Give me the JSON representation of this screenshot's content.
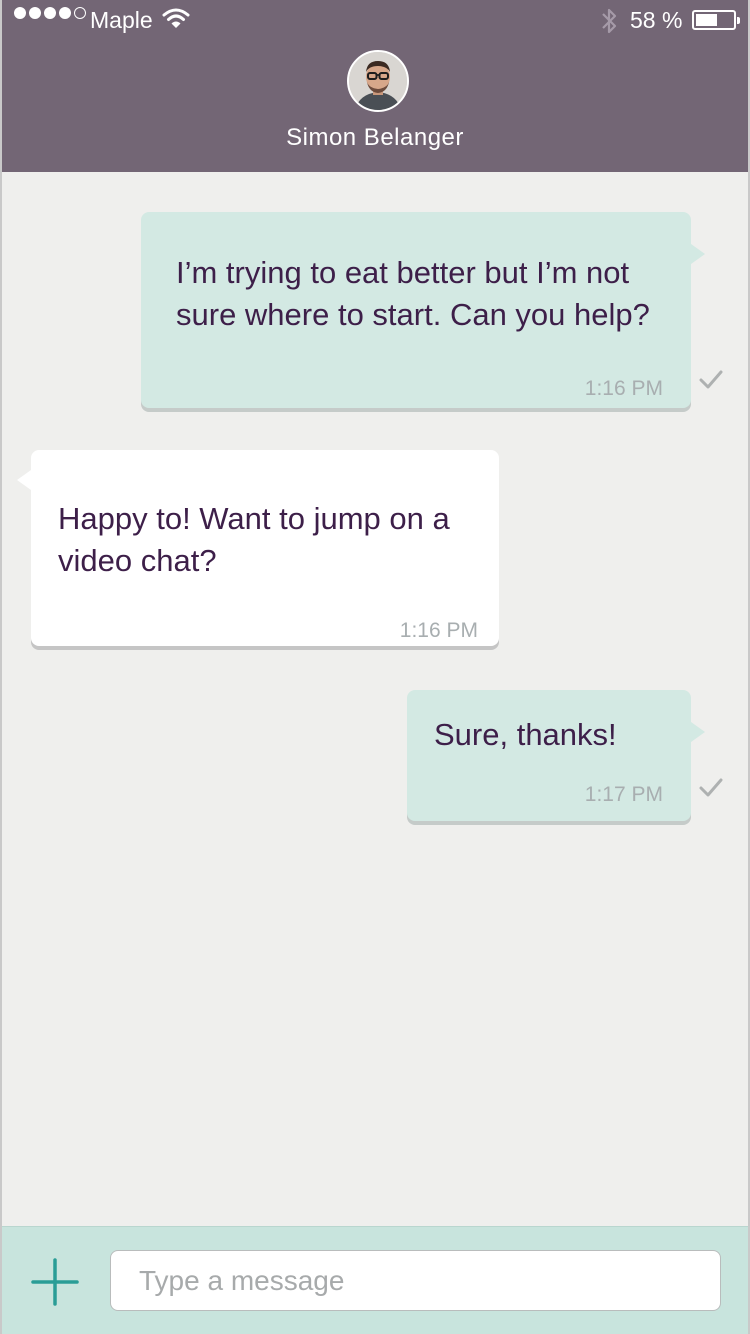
{
  "status_bar": {
    "carrier": "Maple",
    "battery": "58 %",
    "battery_level": 0.58
  },
  "header": {
    "contact_name": "Simon Belanger"
  },
  "messages": [
    {
      "direction": "outgoing",
      "text": "I’m trying to eat better but I’m not sure where to start. Can you help?",
      "line1": "I’m trying to eat better but I’m not",
      "line2": "sure where to start. Can you help?",
      "time": "1:16 PM",
      "status_icon": "check-icon"
    },
    {
      "direction": "incoming",
      "text": "Happy to! Want to jump on a video chat?",
      "line1": "Happy to! Want to jump on a",
      "line2": "video chat?",
      "time": "1:16 PM"
    },
    {
      "direction": "outgoing",
      "text": "Sure, thanks!",
      "line1": "Sure, thanks!",
      "time": "1:17 PM",
      "status_icon": "check-icon"
    }
  ],
  "composer": {
    "placeholder": "Type a message",
    "value": "",
    "add_icon": "plus-icon"
  },
  "colors": {
    "header": "#736675",
    "outgoing_bubble": "#d3e9e3",
    "incoming_bubble": "#ffffff",
    "text": "#3d1f49",
    "composer": "#c8e4dd",
    "accent": "#2a9d96"
  }
}
